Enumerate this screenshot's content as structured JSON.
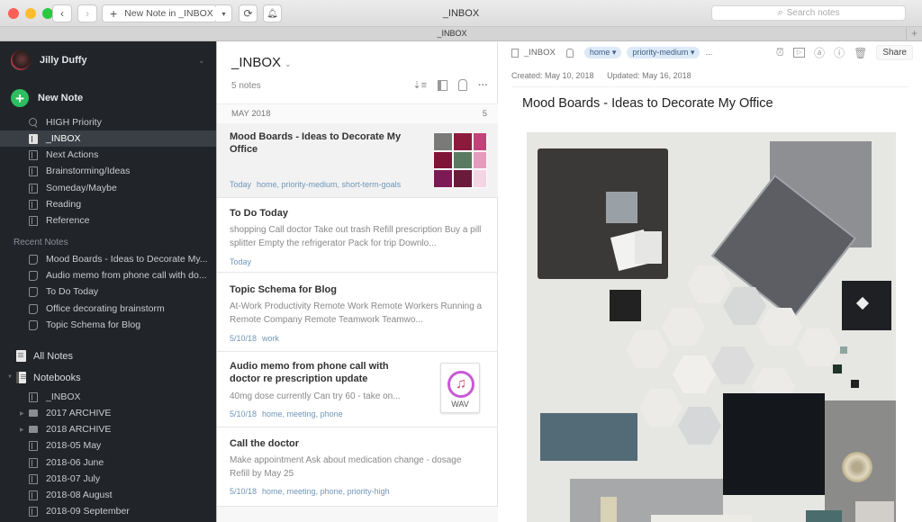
{
  "window": {
    "title": "_INBOX",
    "traffic_lights": {
      "close": "#fc5f57",
      "minimize": "#fdbc2e",
      "zoom": "#29c940"
    },
    "toolbar": {
      "back_icon": "chevron-left-icon",
      "forward_icon": "chevron-right-icon",
      "new_note_label": "New Note in _INBOX",
      "new_note_icon": "plus-icon",
      "new_note_dropdown_icon": "chevron-down-icon",
      "sync_icon": "sync-icon",
      "notifications_icon": "bell-icon"
    },
    "search": {
      "placeholder": "Search notes",
      "icon": "search-icon"
    },
    "tab": {
      "label": "_INBOX",
      "add_icon": "plus-icon"
    }
  },
  "sidebar": {
    "user": {
      "name": "Jilly Duffy"
    },
    "new_note_label": "New Note",
    "shortcuts": [
      {
        "label": "HIGH Priority",
        "icon": "search-icon",
        "active": false
      },
      {
        "label": "_INBOX",
        "icon": "notebook-icon",
        "active": true
      },
      {
        "label": "Next Actions",
        "icon": "notebook-icon",
        "active": false
      },
      {
        "label": "Brainstorming/Ideas",
        "icon": "notebook-icon",
        "active": false
      },
      {
        "label": "Someday/Maybe",
        "icon": "notebook-icon",
        "active": false
      },
      {
        "label": "Reading",
        "icon": "notebook-icon",
        "active": false
      },
      {
        "label": "Reference",
        "icon": "notebook-icon",
        "active": false
      }
    ],
    "recent_notes_label": "Recent Notes",
    "recent_notes": [
      "Mood Boards - Ideas to Decorate My...",
      "Audio memo from phone call with do...",
      "To Do Today",
      "Office decorating brainstorm",
      "Topic Schema for Blog"
    ],
    "all_notes_label": "All Notes",
    "notebooks_label": "Notebooks",
    "notebooks": [
      {
        "label": "_INBOX",
        "stack": false
      },
      {
        "label": "2017 ARCHIVE",
        "stack": true
      },
      {
        "label": "2018 ARCHIVE",
        "stack": true
      },
      {
        "label": "2018-05 May",
        "stack": false
      },
      {
        "label": "2018-06 June",
        "stack": false
      },
      {
        "label": "2018-07 July",
        "stack": false
      },
      {
        "label": "2018-08 August",
        "stack": false
      },
      {
        "label": "2018-09 September",
        "stack": false
      }
    ]
  },
  "note_list": {
    "title": "_INBOX",
    "count": "5 notes",
    "tools": [
      "sort-icon",
      "view-options-icon",
      "tag-filter-icon",
      "more-icon"
    ],
    "month_group": {
      "label": "MAY 2018",
      "count": "5"
    },
    "notes": [
      {
        "title": "Mood Boards - Ideas to Decorate My Office",
        "snippet": "",
        "date": "Today",
        "tags": "home, priority-medium, short-term-goals",
        "thumbnail": "mood-board-image",
        "selected": true
      },
      {
        "title": "To Do Today",
        "snippet": "shopping Call doctor Take out trash Refill prescription Buy a pill splitter Empty the refrigerator Pack for trip Downlo...",
        "date": "Today",
        "tags": "",
        "selected": false
      },
      {
        "title": "Topic Schema for Blog",
        "snippet": "At-Work Productivity Remote Work Remote Workers Running a Remote Company Remote Teamwork Teamwo...",
        "date": "5/10/18",
        "tags": "work",
        "selected": false
      },
      {
        "title": "Audio memo from phone call with doctor re prescription update",
        "snippet": "40mg dose currently Can try 60 - take on...",
        "date": "5/10/18",
        "tags": "home, meeting, phone",
        "thumbnail": "wav-file-icon",
        "thumbnail_label": "WAV",
        "selected": false
      },
      {
        "title": "Call the doctor",
        "snippet": "Make appointment Ask about medication change - dosage Refill by May 25",
        "date": "5/10/18",
        "tags": "home, meeting, phone, priority-high",
        "selected": false
      }
    ]
  },
  "editor": {
    "notebook": "_INBOX",
    "tags": [
      "home",
      "priority-medium"
    ],
    "more_tags": "...",
    "created": "Created: May 10, 2018",
    "updated": "Updated: May 16, 2018",
    "toolbar_icons": [
      "reminder-icon",
      "presentation-icon",
      "mention-icon",
      "info-icon",
      "trash-icon"
    ],
    "share_label": "Share",
    "title": "Mood Boards - Ideas to Decorate My Office",
    "image": "tile-mood-board-photo"
  }
}
